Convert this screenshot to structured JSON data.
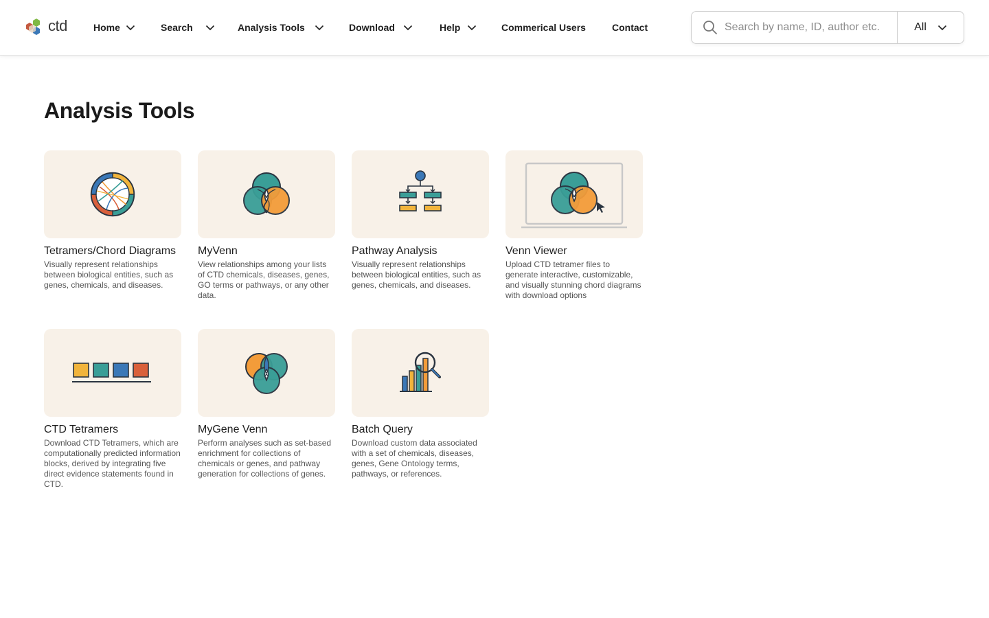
{
  "header": {
    "logo_text": "ctd",
    "nav": [
      {
        "label": "Home",
        "has_dropdown": true
      },
      {
        "label": "Search",
        "has_dropdown": true
      },
      {
        "label": "Analysis Tools",
        "has_dropdown": true
      },
      {
        "label": "Download",
        "has_dropdown": true
      },
      {
        "label": "Help",
        "has_dropdown": true
      },
      {
        "label": "Commerical Users",
        "has_dropdown": false
      },
      {
        "label": "Contact",
        "has_dropdown": false
      }
    ],
    "search": {
      "placeholder": "Search by name, ID, author etc.",
      "value": "",
      "scope": "All"
    }
  },
  "main": {
    "title": "Analysis Tools",
    "tools": [
      {
        "title": "Tetramers/Chord Diagrams",
        "description": "Visually represent relationships between biological entities, such as genes, chemicals, and diseases.",
        "icon": "chord-diagram-icon"
      },
      {
        "title": "MyVenn",
        "description": "View relationships among your lists of CTD chemicals, diseases, genes, GO terms or pathways, or any other data.",
        "icon": "venn-diagram-icon"
      },
      {
        "title": "Pathway Analysis",
        "description": "Visually represent relationships between biological entities, such as genes, chemicals, and diseases.",
        "icon": "pathway-icon"
      },
      {
        "title": "Venn Viewer",
        "description": "Upload CTD tetramer files to generate interactive, customizable, and visually stunning chord diagrams with download options",
        "icon": "venn-viewer-icon"
      },
      {
        "title": "CTD Tetramers",
        "description": "Download CTD Tetramers, which are computationally predicted information blocks, derived by integrating five direct evidence statements found in CTD.",
        "icon": "tetramer-blocks-icon"
      },
      {
        "title": "MyGene Venn",
        "description": "Perform analyses such as set-based enrichment for collections of chemicals or genes, and pathway generation for collections of genes.",
        "icon": "gene-venn-icon"
      },
      {
        "title": "Batch Query",
        "description": "Download custom data associated with a set of chemicals, diseases, genes, Gene Ontology terms, pathways, or references.",
        "icon": "batch-query-icon"
      }
    ]
  },
  "colors": {
    "card_background": "#f8f1e8",
    "teal": "#3a9e97",
    "blue": "#3b78b7",
    "orange": "#f39c3a",
    "yellow": "#f1b43c",
    "red": "#d9603b",
    "outline": "#2a3440"
  }
}
